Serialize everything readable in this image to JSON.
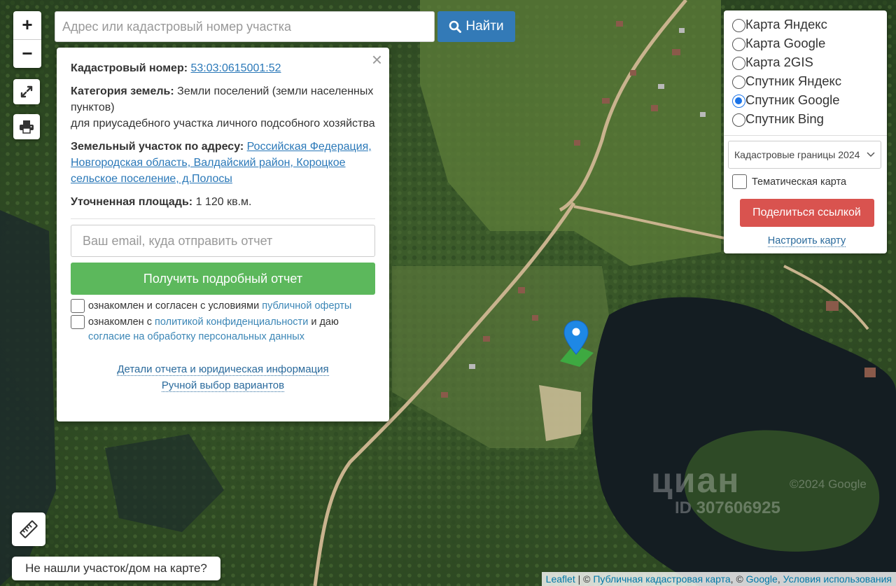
{
  "map": {
    "zoom_in": "+",
    "zoom_out": "−",
    "fullscreen_icon": "expand-icon",
    "print_icon": "printer-icon",
    "ruler_icon": "ruler-icon",
    "marker_icon": "map-pin-icon"
  },
  "search": {
    "placeholder": "Адрес или кадастровый номер участка",
    "button_label": "Найти",
    "button_icon": "search-icon"
  },
  "popup": {
    "close": "×",
    "cadastral_label": "Кадастровый номер:",
    "cadastral_value": "53:03:0615001:52",
    "category_label": "Категория земель:",
    "category_value": "Земли поселений (земли населенных пунктов)",
    "usage_value": "для приусадебного участка личного подсобного хозяйства",
    "address_label": "Земельный участок по адресу:",
    "address_value": "Российская Федерация, Новгородская область, Валдайский район, Короцкое сельское поселение, д.Полосы",
    "area_label": "Уточненная площадь:",
    "area_value": "1 120 кв.м.",
    "email_placeholder": "Ваш email, куда отправить отчет",
    "report_button": "Получить подробный отчет",
    "agree1_text": "ознакомлен и согласен с условиями",
    "agree1_link": "публичной оферты",
    "agree2_text": "ознакомлен с",
    "agree2_link": "политикой конфиденциальности",
    "agree2_text2": "и даю",
    "agree2_link2": "согласие на обработку персональных данных",
    "details_link": "Детали отчета и юридическая информация",
    "manual_link": "Ручной выбор вариантов"
  },
  "layers": {
    "options": [
      {
        "label": "Карта Яндекс",
        "selected": false
      },
      {
        "label": "Карта Google",
        "selected": false
      },
      {
        "label": "Карта 2GIS",
        "selected": false
      },
      {
        "label": "Спутник Яндекс",
        "selected": false
      },
      {
        "label": "Спутник Google",
        "selected": true
      },
      {
        "label": "Спутник Bing",
        "selected": false
      }
    ],
    "overlay_select": "Кадастровые границы 2024",
    "thematic_label": "Тематическая карта",
    "share_button": "Поделиться ссылкой",
    "configure_link": "Настроить карту"
  },
  "bottom": {
    "not_found": "Не нашли участок/дом на карте?"
  },
  "attribution": {
    "leaflet": "Leaflet",
    "sep1": "| ©",
    "pkk": "Публичная кадастровая карта",
    "sep2": ", ©",
    "google": "Google",
    "sep3": ",",
    "terms": "Условия использования"
  },
  "watermark": {
    "brand": "циан",
    "id": "ID 307606925",
    "google": "©2024 Google"
  },
  "colors": {
    "primary": "#337ab7",
    "success": "#5cb85c",
    "danger": "#d9534f",
    "marker": "#1e88e5",
    "parcel": "#3cb043"
  }
}
